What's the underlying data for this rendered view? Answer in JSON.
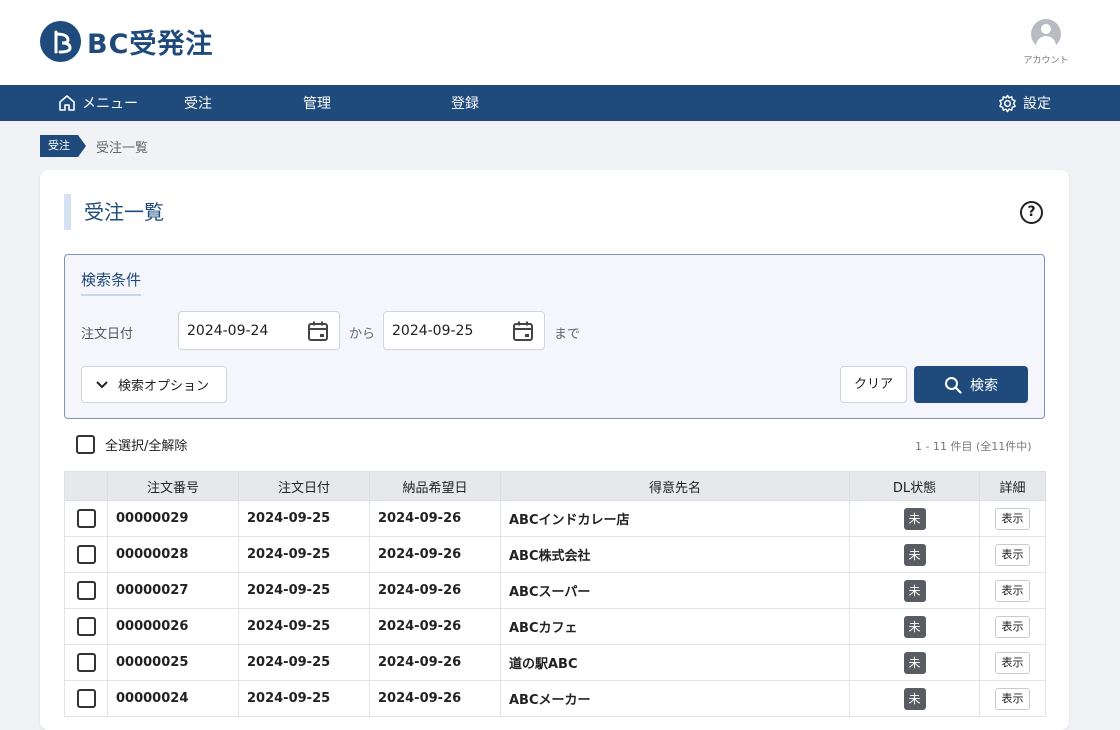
{
  "header": {
    "logo_text": "BC受発注",
    "account_label": "アカウント"
  },
  "nav": {
    "menu": "メニュー",
    "orders": "受注",
    "management": "管理",
    "register": "登録",
    "settings": "設定"
  },
  "breadcrumb": {
    "tag": "受注",
    "current": "受注一覧"
  },
  "page": {
    "title": "受注一覧",
    "help": "?"
  },
  "search": {
    "title": "検索条件",
    "date_label": "注文日付",
    "date_from": "2024-09-24",
    "from_text": "から",
    "date_to": "2024-09-25",
    "to_text": "まで",
    "options_label": "検索オプション",
    "clear_label": "クリア",
    "search_label": "検索"
  },
  "list": {
    "select_all_label": "全選択/全解除",
    "count_text": "1 - 11 件目 (全11件中)",
    "columns": {
      "order_no": "注文番号",
      "order_date": "注文日付",
      "delivery_date": "納品希望日",
      "customer": "得意先名",
      "dl_status": "DL状態",
      "detail": "詳細"
    },
    "rows": [
      {
        "order_no": "00000029",
        "order_date": "2024-09-25",
        "delivery_date": "2024-09-26",
        "customer": "ABCインドカレー店",
        "dl": "未",
        "detail": "表示"
      },
      {
        "order_no": "00000028",
        "order_date": "2024-09-25",
        "delivery_date": "2024-09-26",
        "customer": "ABC株式会社",
        "dl": "未",
        "detail": "表示"
      },
      {
        "order_no": "00000027",
        "order_date": "2024-09-25",
        "delivery_date": "2024-09-26",
        "customer": "ABCスーパー",
        "dl": "未",
        "detail": "表示"
      },
      {
        "order_no": "00000026",
        "order_date": "2024-09-25",
        "delivery_date": "2024-09-26",
        "customer": "ABCカフェ",
        "dl": "未",
        "detail": "表示"
      },
      {
        "order_no": "00000025",
        "order_date": "2024-09-25",
        "delivery_date": "2024-09-26",
        "customer": "道の駅ABC",
        "dl": "未",
        "detail": "表示"
      },
      {
        "order_no": "00000024",
        "order_date": "2024-09-25",
        "delivery_date": "2024-09-26",
        "customer": "ABCメーカー",
        "dl": "未",
        "detail": "表示"
      }
    ]
  },
  "colors": {
    "brand": "#1f4a7c",
    "background": "#f0f2f5",
    "badge": "#595d63"
  }
}
